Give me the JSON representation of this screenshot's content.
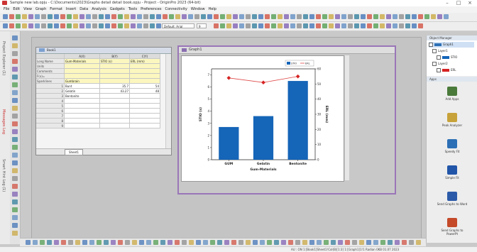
{
  "window": {
    "title": "Sample new lab.opju - C:\\Documents\\2023\\Graphs detail detail book.opju - Project - OriginPro 2023 (64-bit)",
    "controls": [
      "–",
      "□",
      "×"
    ]
  },
  "menu": [
    "File",
    "Edit",
    "View",
    "Graph",
    "Format",
    "Insert",
    "Data",
    "Analysis",
    "Gadgets",
    "Tools",
    "Preferences",
    "Connectivity",
    "Window",
    "Help"
  ],
  "toolbar": {
    "font_box": "Default: Arial",
    "size_box": "9",
    "text_box": "Text Edit"
  },
  "left_sidebar_labels": [
    "Project Explorer (1)",
    "Messages Log",
    "Smart Hint Log (1)"
  ],
  "worksheet": {
    "title": "Book1",
    "row_headers": [
      "Long Name",
      "Units",
      "Comments",
      "F(x)=",
      "Sparklines",
      "1",
      "2",
      "3",
      "4",
      "5",
      "6",
      "7",
      "8",
      "9"
    ],
    "columns": [
      "A(X)",
      "B(Y)",
      "C(Y)"
    ],
    "meta_rows": [
      [
        "Gum-Materials",
        "STIO (s)",
        "ERL (mm)"
      ],
      [
        "",
        "",
        ""
      ],
      [
        "",
        "",
        ""
      ],
      [
        "",
        "",
        ""
      ],
      [
        "Gumbrain",
        "",
        ""
      ]
    ],
    "data_rows": [
      [
        "Bunt",
        "35.7",
        "54"
      ],
      [
        "Gelatin",
        "43.27",
        "48"
      ],
      [
        "Bentonite",
        "",
        ""
      ]
    ],
    "sheet_tab": "Sheet1"
  },
  "graph_window": {
    "title": "Graph1"
  },
  "chart_data": {
    "type": "bar",
    "categories": [
      "GUM",
      "Gelatin",
      "Bentonite"
    ],
    "series": [
      {
        "name": "STIO",
        "type": "bar",
        "axis": "left",
        "values": [
          2.7,
          3.6,
          6.5
        ]
      },
      {
        "name": "ERL",
        "type": "line",
        "axis": "right",
        "values": [
          54,
          51,
          55
        ]
      }
    ],
    "xlabel": "Gum-Materials",
    "ylabel": "STIO (s)",
    "y2label": "ERL (mm)",
    "ylim": [
      0,
      7.5
    ],
    "y2lim": [
      0,
      60
    ],
    "yticks": [
      "0",
      "1",
      "2",
      "3",
      "4",
      "5",
      "6",
      "7"
    ],
    "y2ticks": [
      "0",
      "10",
      "20",
      "30",
      "40",
      "50",
      "60"
    ],
    "legend": [
      "STIO",
      "ERL"
    ],
    "legend_placement": "top-right",
    "colors": {
      "bar": "#1565b8",
      "line": "#e04a4a",
      "marker": "#d62222"
    }
  },
  "object_manager": {
    "title": "Object Manager",
    "items": [
      "Graph1",
      "Layer1",
      "STIO",
      "Layer2",
      "ERL"
    ]
  },
  "apps": {
    "title": "Apps",
    "items": [
      {
        "label": "Add Apps",
        "icon": "plus-icon",
        "color": "#4a7a3a"
      },
      {
        "label": "Peak Analyzer",
        "icon": "peak-icon",
        "color": "#c7a23a"
      },
      {
        "label": "Speedy Fit",
        "icon": "fit-icon",
        "color": "#2c6fb5"
      },
      {
        "label": "Simple Fit",
        "icon": "fit-icon",
        "color": "#2155a8"
      },
      {
        "label": "Send Graphs to Word",
        "icon": "word-icon",
        "color": "#2b5aa8"
      },
      {
        "label": "Send Graphs to PowerPt",
        "icon": "ppt-icon",
        "color": "#c44a2a"
      }
    ]
  },
  "status": {
    "left": "",
    "right": "AU : ON  1:[Book1]Sheet1!Col(B)[1:3]  1:[Graph1]1!1  Radian  0KB  01.07 2023"
  }
}
